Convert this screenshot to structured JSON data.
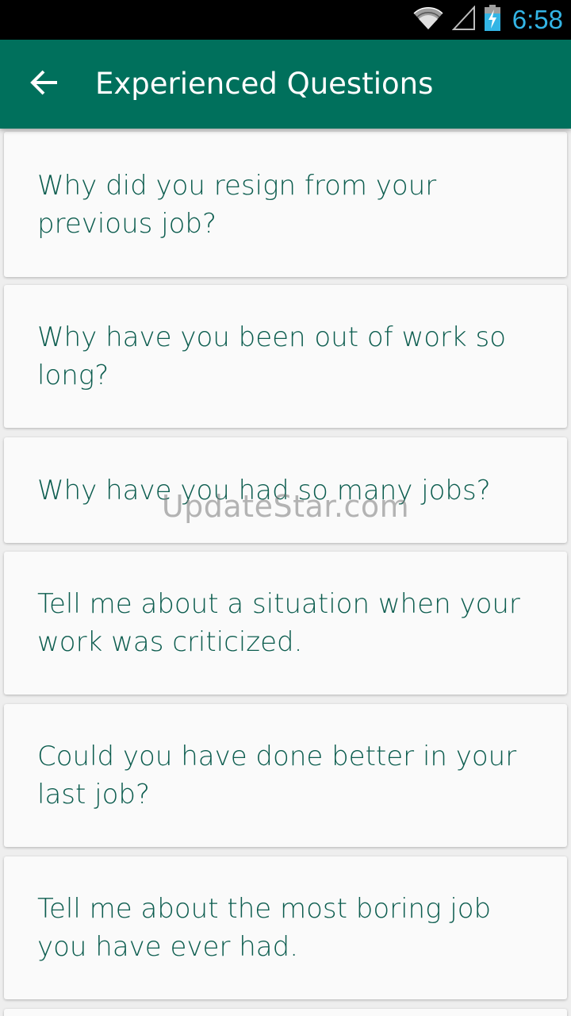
{
  "status_bar": {
    "time": "6:58",
    "wifi_icon": "wifi-icon",
    "signal_icon": "cell-signal-icon",
    "battery_icon": "battery-charging-icon",
    "time_color": "#33b5e5"
  },
  "app_bar": {
    "title": "Experienced Questions",
    "back_icon": "arrow-back-icon",
    "color": "#00705c"
  },
  "questions": [
    "Why did you resign from your previous job?",
    "Why have you been out of work so long?",
    "Why have you had so many jobs?",
    "Tell me about a situation when your work was criticized.",
    "Could you have done better in your last job?",
    "Tell me about the most boring job you have ever had."
  ],
  "watermark": "UpdateStar.com",
  "colors": {
    "question_text": "#0d5d4f",
    "card_background": "#fafafa",
    "page_background": "#eeeeee"
  }
}
